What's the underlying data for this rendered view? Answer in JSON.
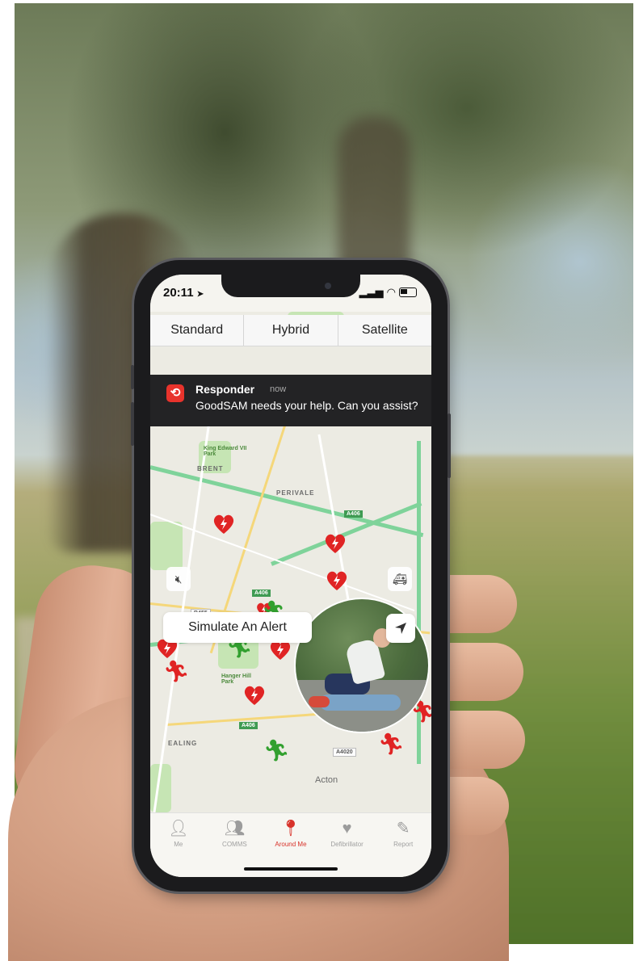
{
  "status_bar": {
    "time": "20:11",
    "location_arrow": "◂",
    "signal": "ııl",
    "wifi": "wifi-icon"
  },
  "map_type": {
    "options": [
      "Standard",
      "Hybrid",
      "Satellite"
    ]
  },
  "notification": {
    "app": "Responder",
    "time": "now",
    "message": "GoodSAM needs your help. Can you assist?"
  },
  "map_labels": {
    "brent": "BRENT",
    "ealing": "EALING",
    "perivale": "PERIVALE",
    "acton": "Acton",
    "park1": "King Edward VII Park",
    "park2": "Hanger Hill Park",
    "road_a": "A406",
    "road_b": "A4020",
    "road_c": "B455"
  },
  "simulate_button": "Simulate An Alert",
  "tabs": [
    {
      "label": "Me",
      "icon": "person-icon"
    },
    {
      "label": "COMMS",
      "icon": "group-icon"
    },
    {
      "label": "Around Me",
      "icon": "location-pin-icon"
    },
    {
      "label": "Defibrillator",
      "icon": "heart-defib-icon"
    },
    {
      "label": "Report",
      "icon": "report-edit-icon"
    }
  ],
  "active_tab": "Around Me",
  "colors": {
    "alert_red": "#e02424",
    "responder_green": "#32a02f",
    "notification_bg": "#232325"
  }
}
